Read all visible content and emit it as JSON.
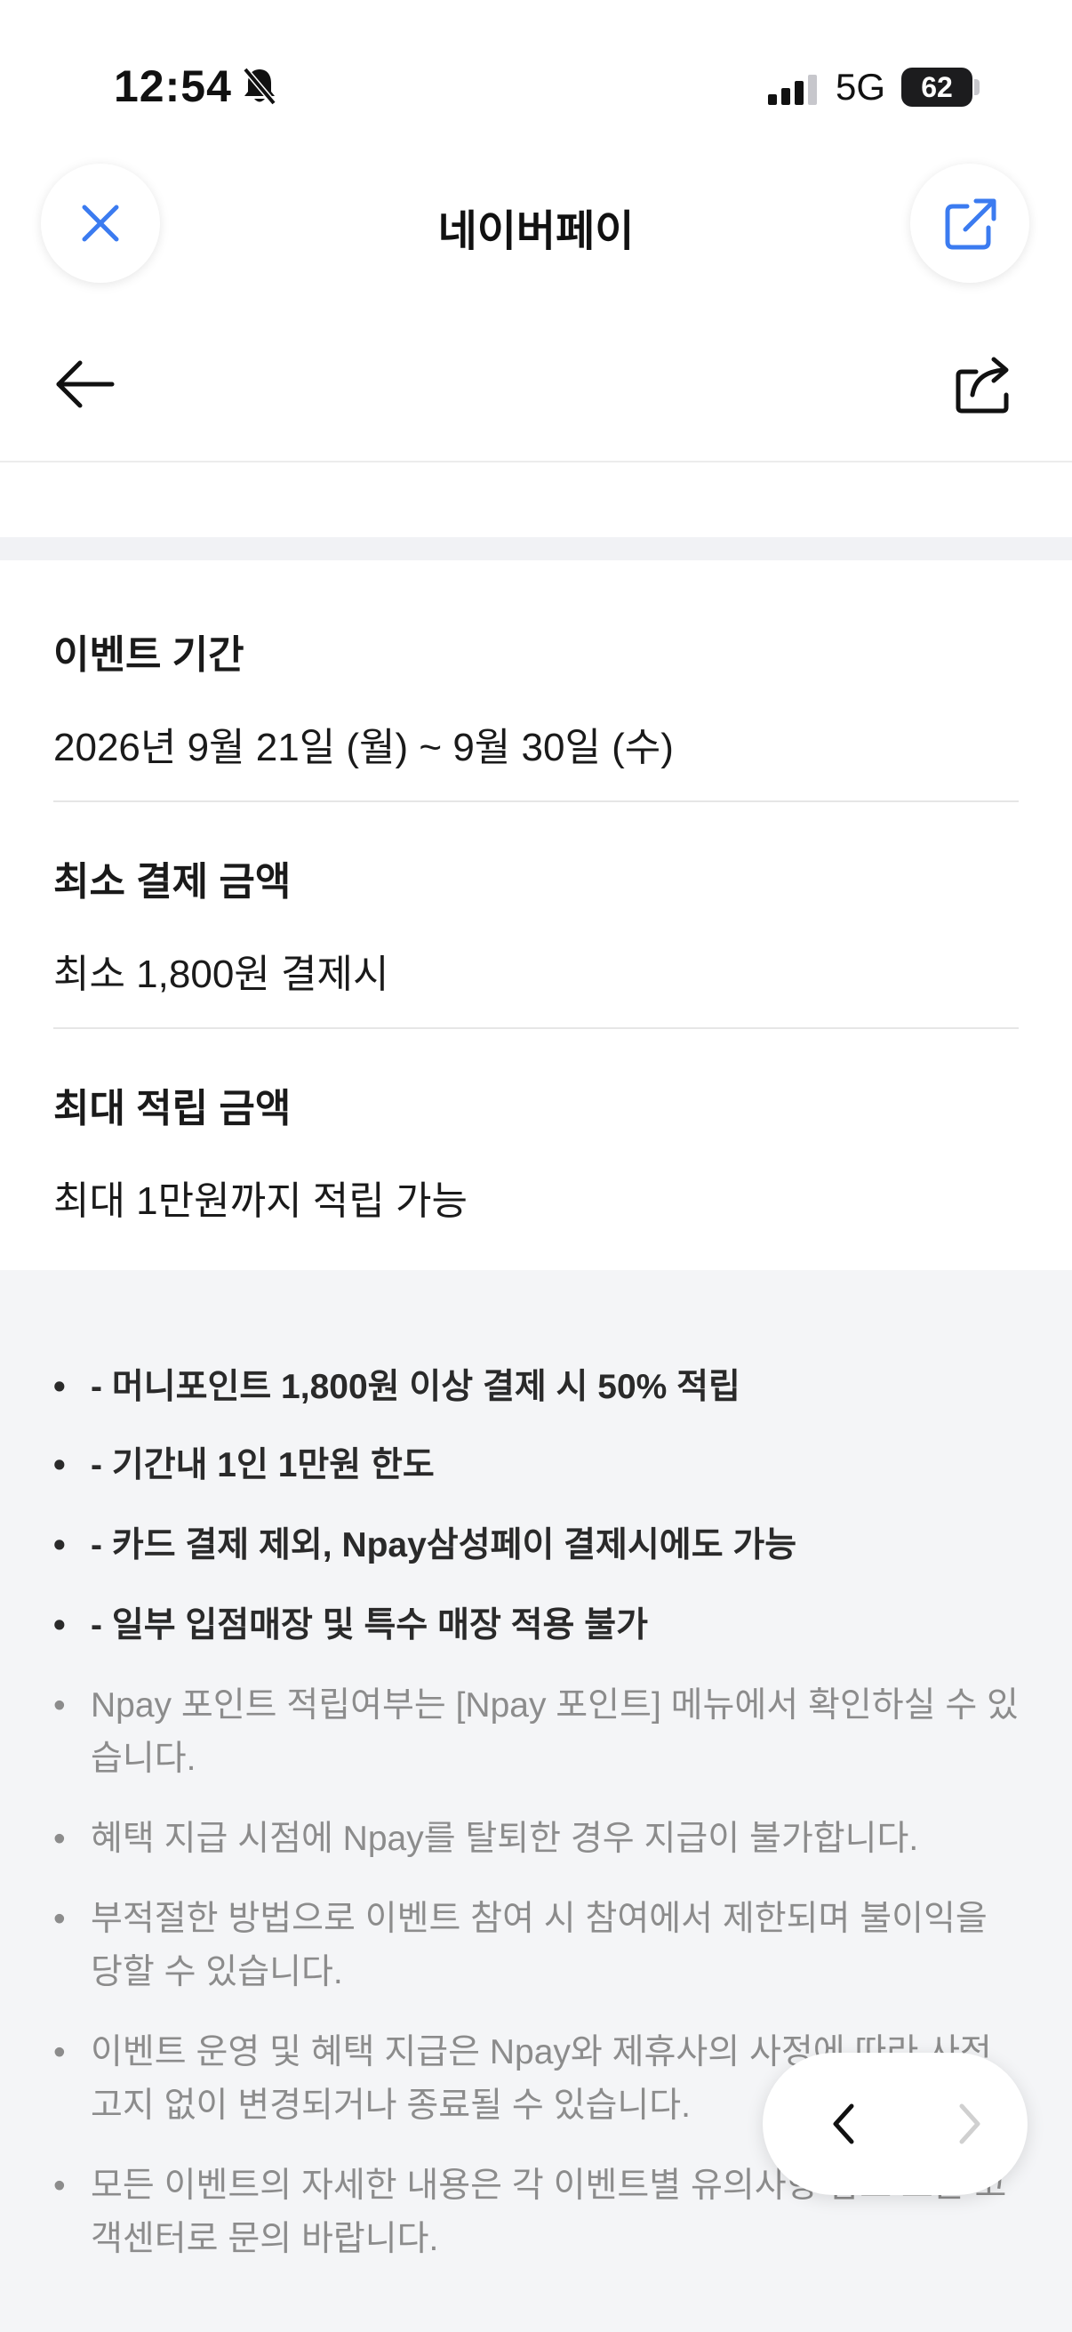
{
  "status_bar": {
    "time": "12:54",
    "network": "5G",
    "battery": "62",
    "icons": [
      "bell-slash-icon",
      "signal-icon",
      "battery-icon"
    ]
  },
  "top_bar": {
    "title": "네이버페이",
    "icons": [
      "close-icon",
      "external-link-icon"
    ],
    "accent_color": "#3b7bf0"
  },
  "nav_bar": {
    "icons": [
      "back-arrow-icon",
      "share-icon"
    ]
  },
  "event_info": [
    {
      "label": "이벤트 기간",
      "value": "2026년 9월 21일 (월) ~ 9월 30일 (수)"
    },
    {
      "label": "최소 결제 금액",
      "value": "최소 1,800원 결제시"
    },
    {
      "label": "최대 적립 금액",
      "value": "최대 1만원까지 적립 가능"
    }
  ],
  "notes": {
    "highlight": [
      "- 머니포인트 1,800원 이상 결제 시 50% 적립",
      "- 기간내 1인 1만원 한도",
      "- 카드 결제 제외, Npay삼성페이 결제시에도 가능",
      "- 일부 입점매장 및 특수 매장 적용 불가"
    ],
    "general": [
      "Npay 포인트 적립여부는 [Npay 포인트] 메뉴에서 확인하실 수 있습니다.",
      "혜택 지급 시점에 Npay를 탈퇴한 경우 지급이 불가합니다.",
      "부적절한 방법으로 이벤트 참여 시 참여에서 제한되며 불이익을 당할 수 있습니다.",
      "이벤트 운영 및 혜택 지급은 Npay와 제휴사의 사정에 따라 사전 고지 없이 변경되거나 종료될 수 있습니다.",
      "모든 이벤트의 자세한 내용은 각 이벤트별 유의사항 참조 또는 고객센터로 문의 바랍니다."
    ]
  },
  "pager": {
    "icons": [
      "chevron-left-icon",
      "chevron-right-icon"
    ]
  }
}
